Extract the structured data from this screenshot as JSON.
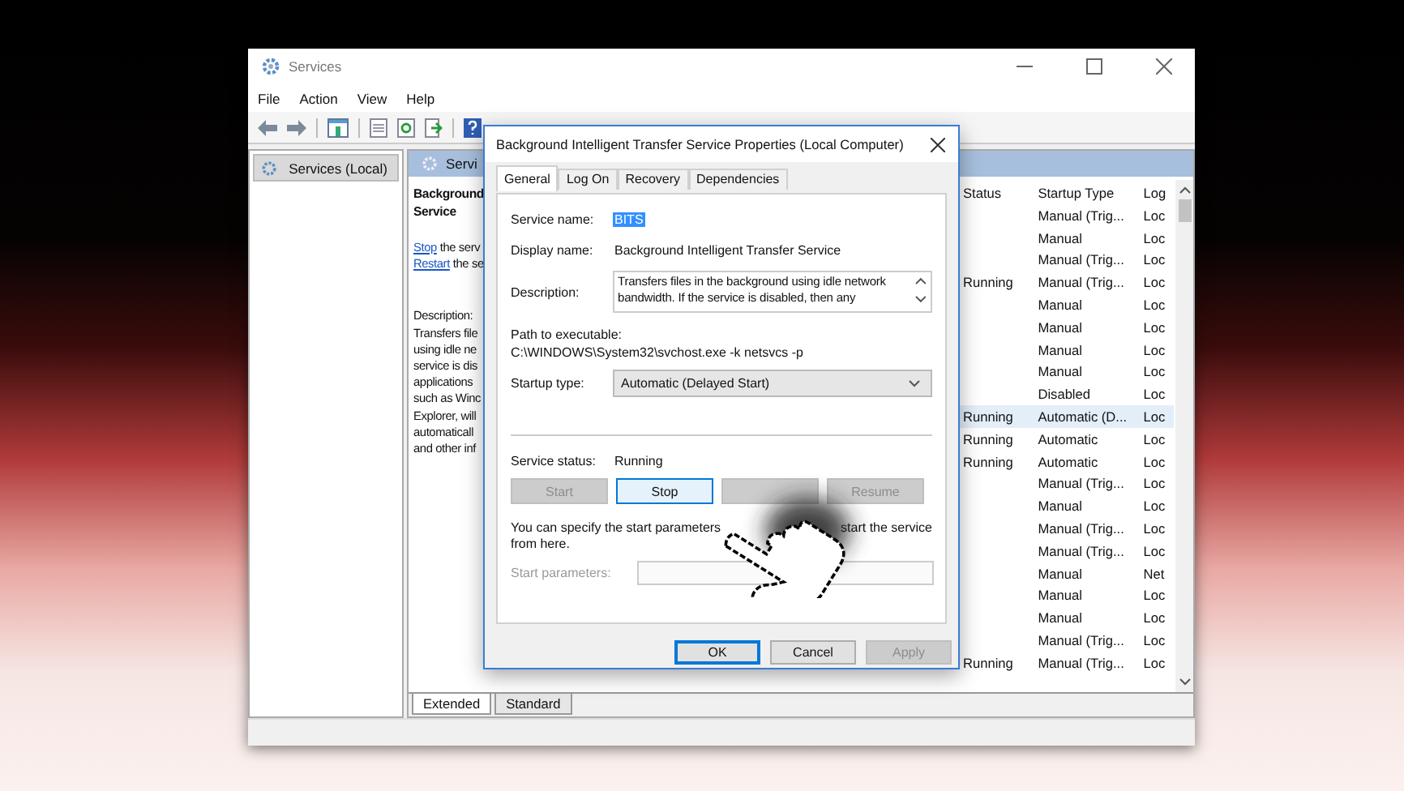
{
  "main_window": {
    "title": "Services",
    "menu": [
      "File",
      "Action",
      "View",
      "Help"
    ],
    "tree": [
      {
        "label": "Services (Local)",
        "selected": true
      }
    ],
    "header": "Servi",
    "extended": {
      "title_lines": [
        "Background",
        "Service"
      ],
      "actions": [
        {
          "link": "Stop",
          "rest": "the serv"
        },
        {
          "link": "Restart",
          "rest": "the se"
        }
      ],
      "description_lines": [
        "Description:",
        "Transfers file",
        "using idle ne",
        "service is dis",
        "applications",
        "such as Winc",
        "Explorer, will",
        "automaticall",
        "and other inf"
      ]
    },
    "list": {
      "columns": [
        "Status",
        "Startup Type",
        "Log"
      ],
      "rows": [
        {
          "startup_type": "Manual (Trig...",
          "log": "Loc",
          "selected": false
        },
        {
          "startup_type": "Manual",
          "log": "Loc",
          "selected": false
        },
        {
          "startup_type": "Manual (Trig...",
          "log": "Loc",
          "selected": false
        },
        {
          "status": "Running",
          "startup_type": "Manual (Trig...",
          "log": "Loc",
          "selected": false
        },
        {
          "startup_type": "Manual",
          "log": "Loc",
          "selected": false
        },
        {
          "startup_type": "Manual",
          "log": "Loc",
          "selected": false
        },
        {
          "startup_type": "Manual",
          "log": "Loc",
          "selected": false
        },
        {
          "startup_type": "Manual",
          "log": "Loc",
          "selected": false
        },
        {
          "startup_type": "Disabled",
          "log": "Loc",
          "selected": false
        },
        {
          "status": "Running",
          "startup_type": "Automatic (D...",
          "log": "Loc",
          "selected": true
        },
        {
          "status": "Running",
          "startup_type": "Automatic",
          "log": "Loc",
          "selected": false
        },
        {
          "status": "Running",
          "startup_type": "Automatic",
          "log": "Loc",
          "selected": false
        },
        {
          "startup_type": "Manual (Trig...",
          "log": "Loc",
          "selected": false
        },
        {
          "startup_type": "Manual",
          "log": "Loc",
          "selected": false
        },
        {
          "startup_type": "Manual (Trig...",
          "log": "Loc",
          "selected": false
        },
        {
          "startup_type": "Manual (Trig...",
          "log": "Loc",
          "selected": false
        },
        {
          "startup_type": "Manual",
          "log": "Net",
          "selected": false
        },
        {
          "startup_type": "Manual",
          "log": "Loc",
          "selected": false
        },
        {
          "startup_type": "Manual",
          "log": "Loc",
          "selected": false
        },
        {
          "startup_type": "Manual (Trig...",
          "log": "Loc",
          "selected": false
        },
        {
          "status": "Running",
          "startup_type": "Manual (Trig...",
          "log": "Loc",
          "selected": false
        }
      ]
    },
    "view_tabs": [
      {
        "label": "Extended",
        "selected": true
      },
      {
        "label": "Standard",
        "selected": false
      }
    ]
  },
  "dialog": {
    "title": "Background Intelligent Transfer Service Properties (Local Computer)",
    "tabs": [
      {
        "label": "General",
        "selected": true
      },
      {
        "label": "Log On",
        "selected": false
      },
      {
        "label": "Recovery",
        "selected": false
      },
      {
        "label": "Dependencies",
        "selected": false
      }
    ],
    "service_name": {
      "label": "Service name:",
      "value": "BITS",
      "highlighted": true
    },
    "display_name": {
      "label": "Display name:",
      "value": "Background Intelligent Transfer Service"
    },
    "description": {
      "label": "Description:",
      "value": "Transfers files in the background using idle network bandwidth. If the service is disabled, then any"
    },
    "path": {
      "label": "Path to executable:",
      "value": "C:\\WINDOWS\\System32\\svchost.exe -k netsvcs -p"
    },
    "startup_type": {
      "label": "Startup type:",
      "value": "Automatic (Delayed Start)"
    },
    "service_status": {
      "label": "Service status:",
      "value": "Running"
    },
    "control_buttons": [
      {
        "label": "Start",
        "disabled": true,
        "focused": false
      },
      {
        "label": "Stop",
        "disabled": false,
        "focused": true
      },
      {
        "disabled": true,
        "focused": false
      },
      {
        "label": "Resume",
        "disabled": true,
        "focused": false
      }
    ],
    "hint_parts": [
      "You can specify the start parameters",
      "start the service",
      "from here."
    ],
    "start_parameters": {
      "label": "Start parameters:",
      "disabled": true
    },
    "buttons": [
      {
        "label": "OK",
        "disabled": false,
        "default": true
      },
      {
        "label": "Cancel",
        "disabled": false,
        "default": false
      },
      {
        "label": "Apply",
        "disabled": true,
        "default": false
      }
    ]
  }
}
